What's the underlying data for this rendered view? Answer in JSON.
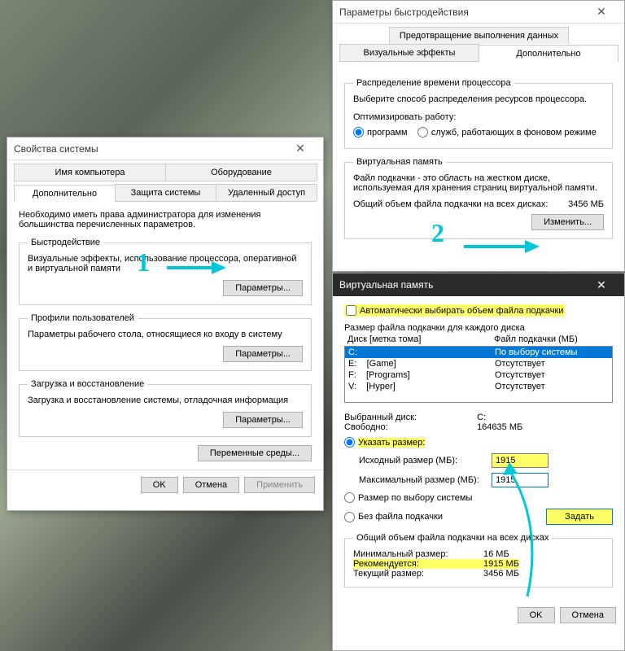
{
  "sysprops": {
    "title": "Свойства системы",
    "tabs_row1": [
      "Имя компьютера",
      "Оборудование"
    ],
    "tabs_row2": [
      "Дополнительно",
      "Защита системы",
      "Удаленный доступ"
    ],
    "intro": "Необходимо иметь права администратора для изменения большинства перечисленных параметров.",
    "perf": {
      "legend": "Быстродействие",
      "text": "Визуальные эффекты, использование процессора, оперативной и виртуальной памяти",
      "btn": "Параметры..."
    },
    "profiles": {
      "legend": "Профили пользователей",
      "text": "Параметры рабочего стола, относящиеся ко входу в систему",
      "btn": "Параметры..."
    },
    "startup": {
      "legend": "Загрузка и восстановление",
      "text": "Загрузка и восстановление системы, отладочная информация",
      "btn": "Параметры..."
    },
    "env_btn": "Переменные среды...",
    "ok": "OK",
    "cancel": "Отмена",
    "apply": "Применить"
  },
  "perfopts": {
    "title": "Параметры быстродействия",
    "tabs": [
      "Визуальные эффекты",
      "Дополнительно",
      "Предотвращение выполнения данных"
    ],
    "sched": {
      "legend": "Распределение времени процессора",
      "text": "Выберите способ распределения ресурсов процессора.",
      "optlabel": "Оптимизировать работу:",
      "opt1": "программ",
      "opt2": "служб, работающих в фоновом режиме"
    },
    "vm": {
      "legend": "Виртуальная память",
      "text": "Файл подкачки - это область на жестком диске, используемая для хранения страниц виртуальной памяти.",
      "total_label": "Общий объем файла подкачки на всех дисках:",
      "total_value": "3456 МБ",
      "change_btn": "Изменить..."
    }
  },
  "vmdlg": {
    "title": "Виртуальная память",
    "auto_label": "Автоматически выбирать объем файла подкачки",
    "perlabel": "Размер файла подкачки для каждого диска",
    "col1": "Диск [метка тома]",
    "col2": "Файл подкачки (МБ)",
    "drives": [
      {
        "drive": "C:",
        "label": "",
        "status": "По выбору системы",
        "selected": true
      },
      {
        "drive": "E:",
        "label": "[Game]",
        "status": "Отсутствует",
        "selected": false
      },
      {
        "drive": "F:",
        "label": "[Programs]",
        "status": "Отсутствует",
        "selected": false
      },
      {
        "drive": "V:",
        "label": "[Hyper]",
        "status": "Отсутствует",
        "selected": false
      }
    ],
    "selected_drive_label": "Выбранный диск:",
    "selected_drive": "C:",
    "free_label": "Свободно:",
    "free_value": "164635 МБ",
    "custom_label": "Указать размер:",
    "initial_label": "Исходный размер (МБ):",
    "initial_value": "1915",
    "max_label": "Максимальный размер (МБ):",
    "max_value": "1915",
    "sys_managed": "Размер по выбору системы",
    "no_file": "Без файла подкачки",
    "set_btn": "Задать",
    "totals": {
      "legend": "Общий объем файла подкачки на всех дисках",
      "min_label": "Минимальный размер:",
      "min_value": "16 МБ",
      "rec_label": "Рекомендуется:",
      "rec_value": "1915 МБ",
      "cur_label": "Текущий размер:",
      "cur_value": "3456 МБ"
    },
    "ok": "OK",
    "cancel": "Отмена"
  },
  "annotations": {
    "one": "1",
    "two": "2"
  }
}
